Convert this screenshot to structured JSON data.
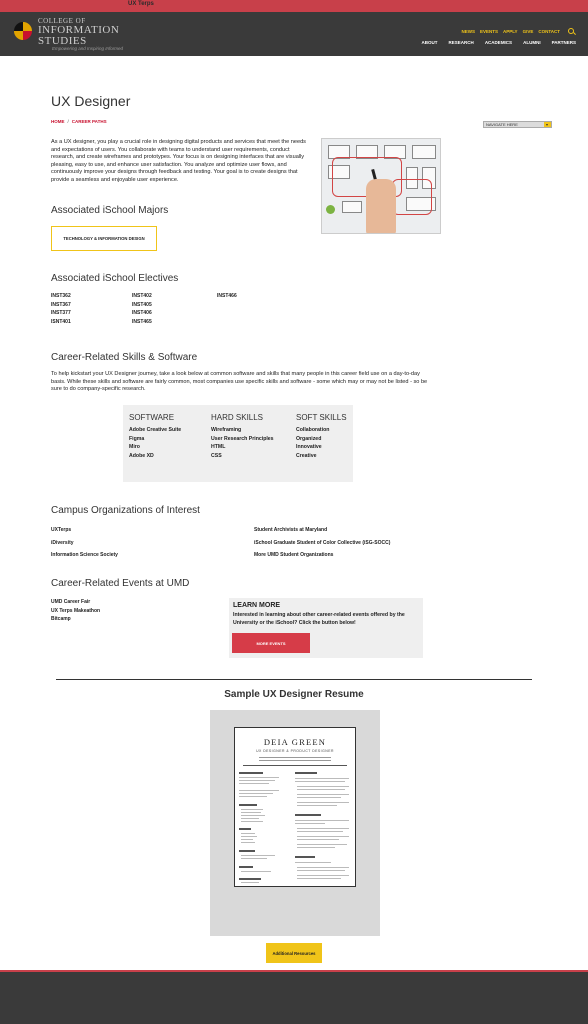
{
  "topbar": {
    "title": "UX Terps"
  },
  "header": {
    "logo": {
      "line1": "COLLEGE OF",
      "line2": "INFORMATION",
      "line3": "STUDIES",
      "tagline": "Empowering and Inspiring Informed"
    },
    "util_nav": [
      "NEWS",
      "EVENTS",
      "APPLY",
      "GIVE",
      "CONTACT"
    ],
    "main_nav": [
      "ABOUT",
      "RESEARCH",
      "ACADEMICS",
      "ALUMNI",
      "PARTNERS"
    ]
  },
  "page": {
    "title": "UX Designer",
    "breadcrumb": [
      "HOME",
      "/",
      "CAREER PATHS"
    ],
    "nav_select": "NAVIGATE HERE",
    "intro": "As a UX designer, you play a crucial role in designing digital products and services that meet the needs and expectations of users. You collaborate with teams to understand user requirements, conduct research, and create wireframes and prototypes. Your focus is on designing interfaces that are visually pleasing, easy to use, and enhance user satisfaction. You analyze and optimize user flows, and continuously improve your designs through feedback and testing. Your goal is to create designs that provide a seamless and enjoyable user experience."
  },
  "majors": {
    "heading": "Associated iSchool Majors",
    "items": [
      "TECHNOLOGY & INFORMATION DESIGN"
    ]
  },
  "electives": {
    "heading": "Associated iSchool Electives",
    "col1": [
      "INST362",
      "INST367",
      "INST377",
      "ISNT401"
    ],
    "col2": [
      "INST402",
      "INST405",
      "INST406",
      "INST465"
    ],
    "col3": [
      "INST466"
    ]
  },
  "skills": {
    "heading": "Career-Related Skills & Software",
    "intro": "To help kickstart your UX Designer journey, take a look below at common software and skills that many people in this career field use on a day-to-day basis. While these skills and software are fairly common, most companies use specific skills and software - some which may or may not be listed - so be sure to do company-specific research.",
    "software": {
      "title": "SOFTWARE",
      "items": [
        "Adobe Creative Suite",
        "Figma",
        "Miro",
        "Adobe XD"
      ]
    },
    "hard": {
      "title": "HARD SKILLS",
      "items": [
        "Wireframing",
        "User Research Principles",
        "HTML",
        "CSS"
      ]
    },
    "soft": {
      "title": "SOFT SKILLS",
      "items": [
        "Collaboration",
        "Organized",
        "Innovative",
        "Creative"
      ]
    }
  },
  "orgs": {
    "heading": "Campus Organizations of Interest",
    "left": [
      "UXTerps",
      "iDiversity",
      "Information Science Society"
    ],
    "right": [
      "Student Archivists at Maryland",
      "iSchool Graduate Student of Color Collective (iSG-SOCC)",
      "More UMD Student Organizations"
    ]
  },
  "events": {
    "heading": "Career-Related Events at UMD",
    "items": [
      "UMD Career Fair",
      "UX Terps Makeathon",
      "Bitcamp"
    ],
    "learn_more": {
      "title": "LEARN MORE",
      "text": "Interested in learning about other career-related events offered by the University or the iSchool? Click the button below!",
      "button": "MORE EVENTS"
    }
  },
  "resume": {
    "heading": "Sample UX Designer Resume",
    "name": "DEIA GREEN",
    "subtitle": "UX DESIGNER & PRODUCT DESIGNER"
  },
  "additional_resources": "Additional Resources",
  "colors": {
    "brand_red": "#c8404a",
    "brand_gold": "#f0c419",
    "header_bg": "#3a3a3a",
    "button_red": "#d63c48"
  }
}
